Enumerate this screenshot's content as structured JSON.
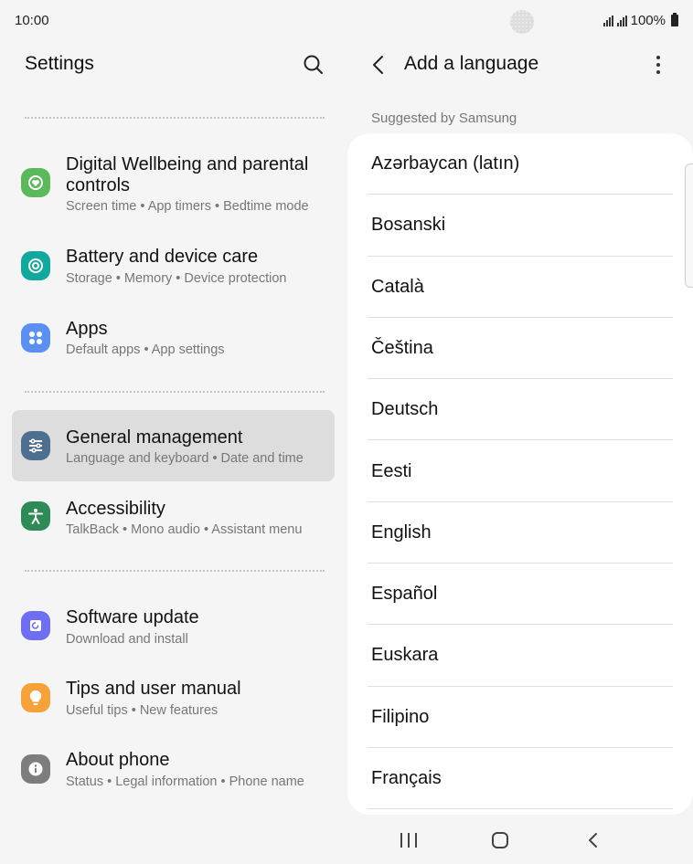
{
  "status": {
    "time": "10:00",
    "battery": "100%"
  },
  "settings": {
    "title": "Settings",
    "items": [
      {
        "title": "Digital Wellbeing and parental controls",
        "subtitle": "Screen time • App timers • Bedtime mode",
        "icon": "digital-wellbeing-icon",
        "color": "#5cb85c"
      },
      {
        "title": "Battery and device care",
        "subtitle": "Storage • Memory • Device protection",
        "icon": "device-care-icon",
        "color": "#13a89e"
      },
      {
        "title": "Apps",
        "subtitle": "Default apps • App settings",
        "icon": "apps-icon",
        "color": "#5b8ff0"
      },
      {
        "title": "General management",
        "subtitle": "Language and keyboard • Date and time",
        "icon": "general-management-icon",
        "color": "#4f6f8f",
        "selected": true
      },
      {
        "title": "Accessibility",
        "subtitle": "TalkBack • Mono audio • Assistant menu",
        "icon": "accessibility-icon",
        "color": "#2e8b57"
      },
      {
        "title": "Software update",
        "subtitle": "Download and install",
        "icon": "software-update-icon",
        "color": "#6f6ef0"
      },
      {
        "title": "Tips and user manual",
        "subtitle": "Useful tips • New features",
        "icon": "tips-icon",
        "color": "#f5a23a"
      },
      {
        "title": "About phone",
        "subtitle": "Status • Legal information • Phone name",
        "icon": "info-icon",
        "color": "#7d7d7d"
      }
    ]
  },
  "add_language": {
    "title": "Add a language",
    "section_label": "Suggested by Samsung",
    "languages": [
      "Azərbaycan (latın)",
      "Bosanski",
      "Català",
      "Čeština",
      "Deutsch",
      "Eesti",
      "English",
      "Español",
      "Euskara",
      "Filipino",
      "Français"
    ]
  }
}
